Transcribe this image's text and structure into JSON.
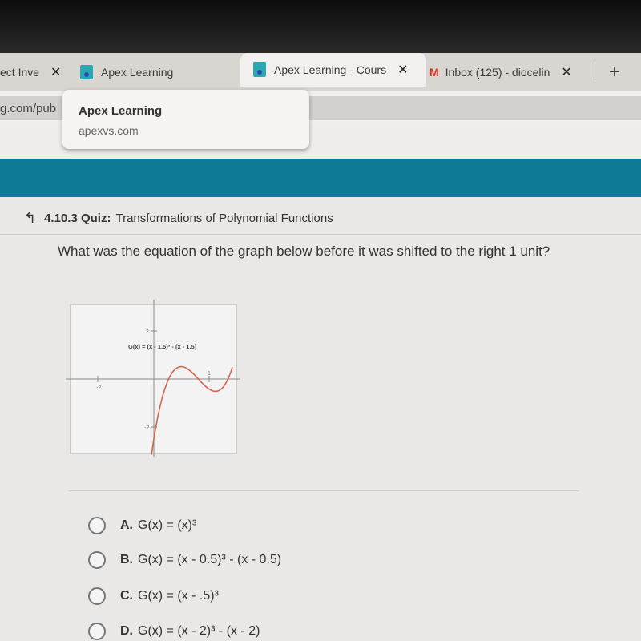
{
  "browser": {
    "tabs": [
      {
        "title": "ect Inve",
        "active": false
      },
      {
        "title": "Apex Learning",
        "active": false
      },
      {
        "title": "Apex Learning - Cours",
        "active": true
      },
      {
        "title": "Inbox (125) - diocelin",
        "active": false
      }
    ],
    "close_glyph": "✕",
    "new_tab_glyph": "+",
    "address_fragment": "g.com/pub",
    "tooltip": {
      "title": "Apex Learning",
      "url": "apexvs.com"
    }
  },
  "quiz": {
    "back_icon": "↰",
    "code": "4.10.3 Quiz:",
    "title": "Transformations of Polynomial Functions",
    "question": "What was the equation of the graph below before it was shifted to the right 1 unit?",
    "graph": {
      "label": "G(x) = (x - 1.5)³ - (x - 1.5)",
      "tick_x_neg": "-2",
      "tick_x_pos": "1",
      "tick_y_pos": "2",
      "tick_y_neg": "-2",
      "curve_color": "#d9644e"
    },
    "options": [
      {
        "letter": "A.",
        "text": "G(x) = (x)³"
      },
      {
        "letter": "B.",
        "text": "G(x) = (x - 0.5)³ - (x - 0.5)"
      },
      {
        "letter": "C.",
        "text": "G(x) = (x - .5)³"
      },
      {
        "letter": "D.",
        "text": "G(x) = (x - 2)³ - (x - 2)"
      }
    ]
  }
}
